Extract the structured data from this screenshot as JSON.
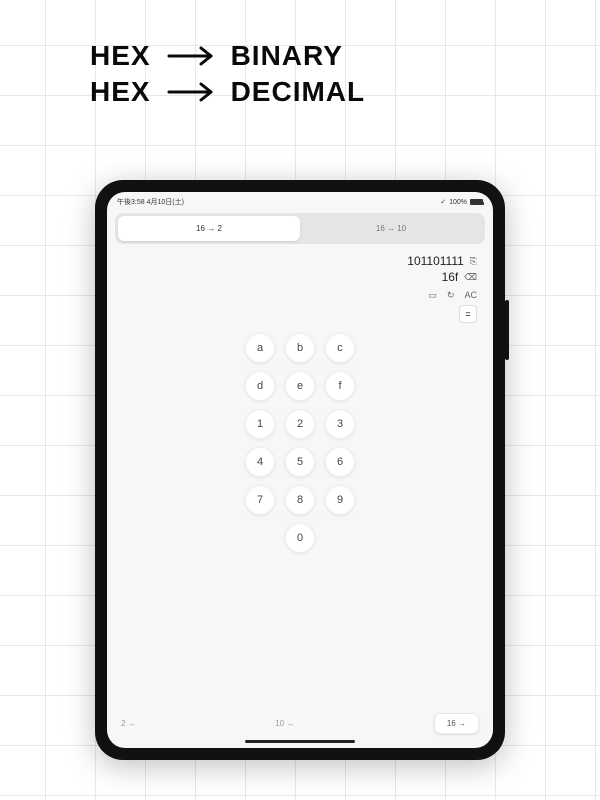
{
  "headline": {
    "line1_from": "HEX",
    "line1_to": "BINARY",
    "line2_from": "HEX",
    "line2_to": "DECIMAL"
  },
  "statusbar": {
    "left": "午後3:58  4月10日(土)",
    "battery_pct": "100%"
  },
  "tabs": {
    "active_label": "16 → 2",
    "inactive_label": "16 → 10"
  },
  "display": {
    "result": "101101111",
    "input": "16f"
  },
  "toolbar": {
    "ac_label": "AC"
  },
  "equals": "=",
  "keypad": [
    [
      "a",
      "b",
      "c"
    ],
    [
      "d",
      "e",
      "f"
    ],
    [
      "1",
      "2",
      "3"
    ],
    [
      "4",
      "5",
      "6"
    ],
    [
      "7",
      "8",
      "9"
    ],
    [
      "0"
    ]
  ],
  "footer": {
    "left": "2 →",
    "mid": "10 →",
    "right": "16 →"
  }
}
